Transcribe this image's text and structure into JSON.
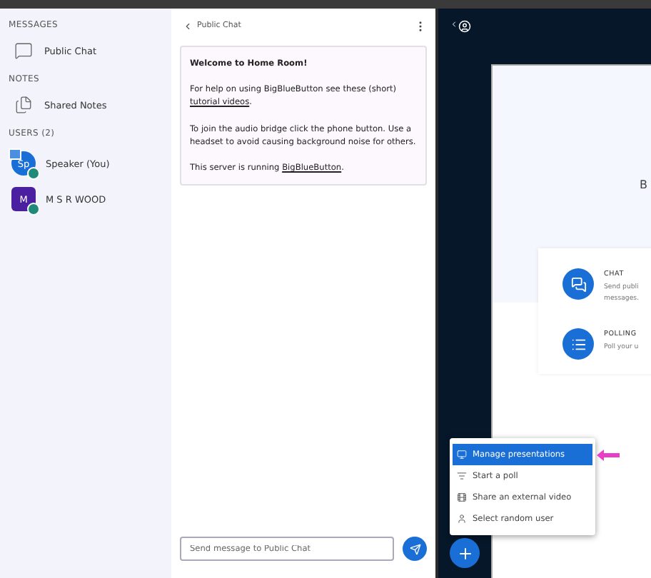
{
  "sidebar": {
    "sections": [
      {
        "heading": "MESSAGES",
        "items": [
          {
            "kind": "chat",
            "label": "Public Chat"
          }
        ]
      },
      {
        "heading": "NOTES",
        "items": [
          {
            "kind": "notes",
            "label": "Shared Notes"
          }
        ]
      }
    ],
    "users_heading": "USERS (2)",
    "users": [
      {
        "initials": "Sp",
        "name": "Speaker (You)",
        "kind": "circle",
        "color": "#1a6fd6",
        "presenter": true
      },
      {
        "initials": "M",
        "name": "M S R WOOD",
        "kind": "square",
        "color": "#4a1fa0",
        "presenter": false
      }
    ]
  },
  "chat": {
    "title": "Public Chat",
    "welcome": [
      "**Welcome to Home Room!**",
      "For help on using BigBlueButton see these (short) ",
      "To join the audio bridge click the phone button. Use a headset to avoid causing background noise for others.",
      "This server is running "
    ],
    "link_tutorial": "tutorial videos",
    "after_tutorial": ".",
    "link_bbb": "BigBlueButton",
    "after_bbb": ".",
    "placeholder": "Send message to Public Chat"
  },
  "presentation": {
    "slide_text": "B",
    "features": [
      {
        "kind": "chat",
        "title": "CHAT",
        "lines": [
          "Send publi",
          "messages."
        ]
      },
      {
        "kind": "poll",
        "title": "POLLING",
        "lines": [
          "Poll your u"
        ]
      }
    ]
  },
  "actions_menu": [
    {
      "kind": "presentation",
      "label": "Manage presentations",
      "selected": true
    },
    {
      "kind": "poll",
      "label": "Start a poll",
      "selected": false
    },
    {
      "kind": "video",
      "label": "Share an external video",
      "selected": false
    },
    {
      "kind": "user",
      "label": "Select random user",
      "selected": false
    }
  ]
}
